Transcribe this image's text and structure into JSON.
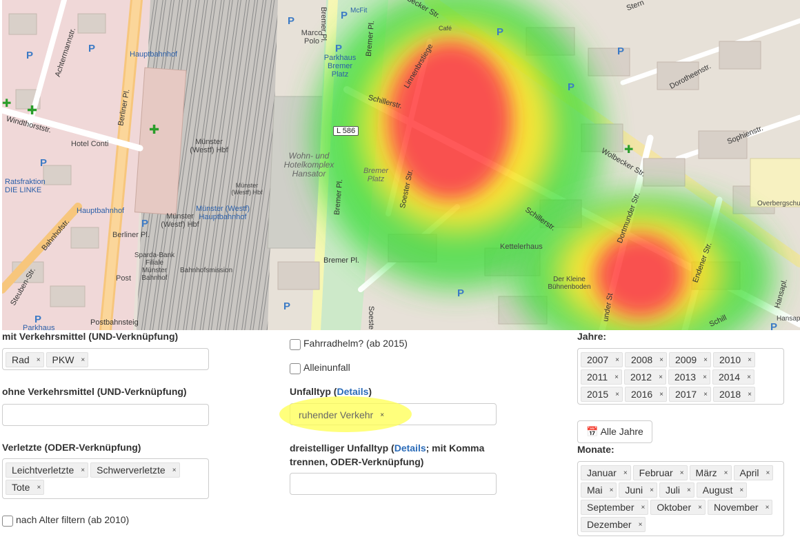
{
  "map": {
    "streets": {
      "achtermannstr": "Achtermannstr.",
      "windthorststr": "Windthorststr.",
      "berliner_pl": "Berliner Pl.",
      "bahnhofstr": "Bahnhofstr.",
      "steuben": "Steuben-Str.",
      "bremer_pl_1": "Bremer Pl.",
      "bremer_pl_2": "Bremer Pl.",
      "bremer_pl_3": "Bremer Pl.",
      "bremer_pl_4": "Bremer Pl.",
      "schillerstr_1": "Schillerstr.",
      "schillerstr_2": "Schillerstr.",
      "linnenbrstiege": "Linnenbrstiege",
      "wolbecker": "Wolbecker Str.",
      "dorotheenstr": "Dorotheenstr.",
      "sophienstr": "Sophienstr.",
      "dortmunder": "Dortmunder Str.",
      "endener": "Endener Str.",
      "soester": "Soester Str.",
      "soester2": "Soeste",
      "postbahnsteig": "Postbahnsteig",
      "hansapl": "Hansapl.",
      "becker": "becker Str.",
      "sterns": "Stern",
      "schill2": "Schill",
      "under": "under St"
    },
    "pois": {
      "hauptbahnhof_1": "Hauptbahnhof",
      "hauptbahnhof_2": "Hauptbahnhof",
      "hotel_conti": "Hotel Conti",
      "ratsfraktion": "Ratsfraktion DIE LINKE",
      "munster_westf_hbf": "Münster (Westf) Hbf",
      "munster_westf_hbf_2": "Münster (Westf) Hbf",
      "munster_westf_hbf_3": "Münster (Westf) Hbf",
      "munster_blue": "Münster (Westf) Hauptbahnhof",
      "berliner_pl_lbl": "Berliner Pl.",
      "sparda": "Sparda-Bank Filiale Münster Bahnhof",
      "post": "Post",
      "bahnhofsmission": "Bahnhofsmission",
      "parkhaus_1": "Parkhaus",
      "parkhaus_2": "Parkhaus Bremer Platz",
      "marco_polo": "Marco Polo",
      "mcfit": "McFit",
      "hansator": "Wohn- und Hotelkomplex Hansator",
      "bremer_platz": "Bremer Platz",
      "kettelerhaus": "Kettelerhaus",
      "buhnenboden": "Der Kleine Bühnenboden",
      "overbergschule": "Overbergschul",
      "cafe": "Café",
      "hansap": "Hansap"
    },
    "road_shield": "L 586"
  },
  "form": {
    "mit_verkehrsmittel": {
      "label": "mit Verkehrsmittel (UND-Verknüpfung)",
      "tags": [
        "Rad",
        "PKW"
      ]
    },
    "ohne_verkehrsmittel": {
      "label": "ohne Verkehrsmittel (UND-Verknüpfung)",
      "tags": []
    },
    "verletzte": {
      "label": "Verletzte (ODER-Verknüpfung)",
      "tags": [
        "Leichtverletzte",
        "Schwerverletzte",
        "Tote"
      ]
    },
    "nach_alter": {
      "label": "nach Alter filtern (ab 2010)",
      "checked": false
    },
    "fahrradhelm": {
      "label": "Fahrradhelm? (ab 2015)",
      "checked": false
    },
    "alleinunfall": {
      "label": "Alleinunfall",
      "checked": false
    },
    "unfalltyp": {
      "label_prefix": "Unfalltyp (",
      "label_link": "Details",
      "label_suffix": ")",
      "tags": [
        "ruhender Verkehr"
      ]
    },
    "dreistelliger": {
      "label_prefix": "dreistelliger Unfalltyp (",
      "label_link": "Details",
      "label_suffix_line1": "; mit Komma",
      "label_line2": "trennen, ODER-Verknüpfung)",
      "value": ""
    },
    "jahre": {
      "label": "Jahre:",
      "tags": [
        "2007",
        "2008",
        "2009",
        "2010",
        "2011",
        "2012",
        "2013",
        "2014",
        "2015",
        "2016",
        "2017",
        "2018"
      ]
    },
    "alle_jahre_button": "Alle Jahre",
    "monate": {
      "label": "Monate:",
      "tags": [
        "Januar",
        "Februar",
        "März",
        "April",
        "Mai",
        "Juni",
        "Juli",
        "August",
        "September",
        "Oktober",
        "November",
        "Dezember"
      ]
    },
    "tag_remove_symbol": "×"
  },
  "colors": {
    "heat_red": "#ff1a1a",
    "heat_yellow": "#ffee00",
    "heat_green": "#22dd22",
    "link": "#2a6bb8",
    "highlight": "#ffff50"
  }
}
